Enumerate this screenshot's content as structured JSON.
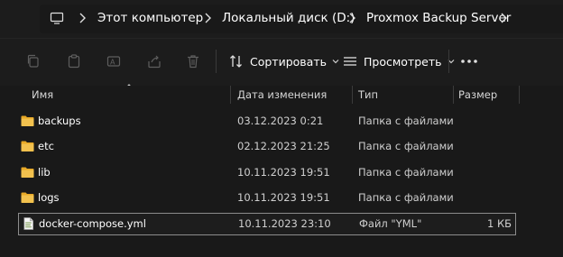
{
  "breadcrumb": {
    "items": [
      "Этот компьютер",
      "Локальный диск (D:)",
      "Proxmox Backup Server"
    ]
  },
  "toolbar": {
    "sort_label": "Сортировать",
    "view_label": "Просмотреть"
  },
  "columns": {
    "name": "Имя",
    "date": "Дата изменения",
    "type": "Тип",
    "size": "Размер"
  },
  "files": [
    {
      "name": "backups",
      "date": "03.12.2023 0:21",
      "type": "Папка с файлами",
      "size": "",
      "kind": "folder"
    },
    {
      "name": "etc",
      "date": "02.12.2023 21:25",
      "type": "Папка с файлами",
      "size": "",
      "kind": "folder"
    },
    {
      "name": "lib",
      "date": "10.11.2023 19:51",
      "type": "Папка с файлами",
      "size": "",
      "kind": "folder"
    },
    {
      "name": "logs",
      "date": "10.11.2023 19:51",
      "type": "Папка с файлами",
      "size": "",
      "kind": "folder"
    },
    {
      "name": "docker-compose.yml",
      "date": "10.11.2023 23:10",
      "type": "Файл \"YML\"",
      "size": "1 КБ",
      "kind": "file"
    }
  ],
  "colors": {
    "background": "#191919",
    "folder": "#f2c14e",
    "selection_border": "#8c8c8c"
  }
}
